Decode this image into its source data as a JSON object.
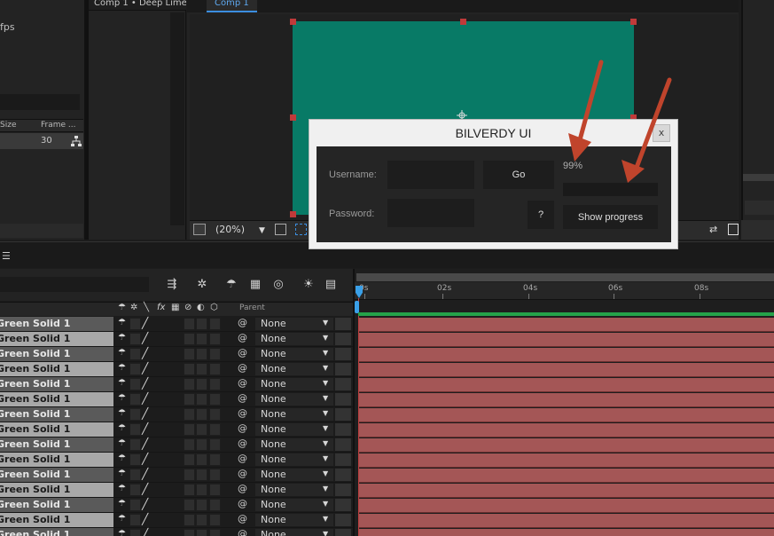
{
  "project_panel": {
    "fps_text": "fps",
    "columns": {
      "size": "Size",
      "frame": "Frame ..."
    },
    "row_frame_value": "30"
  },
  "flowchart_panel": {
    "tab_label": "Comp 1 • Deep Lime"
  },
  "composition_panel": {
    "tab_label": "Comp 1",
    "zoom_label": "(20%)",
    "solid_color": "#087a66"
  },
  "timeline": {
    "parent_column_label": "Parent",
    "ruler_labels": [
      "0s",
      "02s",
      "04s",
      "06s",
      "08s"
    ],
    "layers": [
      {
        "name": "Green Solid 1",
        "parent": "None"
      },
      {
        "name": "Green Solid 1",
        "parent": "None"
      },
      {
        "name": "Green Solid 1",
        "parent": "None"
      },
      {
        "name": "Green Solid 1",
        "parent": "None"
      },
      {
        "name": "Green Solid 1",
        "parent": "None"
      },
      {
        "name": "Green Solid 1",
        "parent": "None"
      },
      {
        "name": "Green Solid 1",
        "parent": "None"
      },
      {
        "name": "Green Solid 1",
        "parent": "None"
      },
      {
        "name": "Green Solid 1",
        "parent": "None"
      },
      {
        "name": "Green Solid 1",
        "parent": "None"
      },
      {
        "name": "Green Solid 1",
        "parent": "None"
      },
      {
        "name": "Green Solid 1",
        "parent": "None"
      },
      {
        "name": "Green Solid 1",
        "parent": "None"
      },
      {
        "name": "Green Solid 1",
        "parent": "None"
      },
      {
        "name": "Green Solid 1",
        "parent": "None"
      }
    ],
    "layer_bar_color": "#a45656"
  },
  "dialog": {
    "title": "BILVERDY UI",
    "close_label": "x",
    "username_label": "Username:",
    "password_label": "Password:",
    "username_value": "",
    "password_value": "",
    "go_label": "Go",
    "help_label": "?",
    "progress_text": "99%",
    "progress_value": 0.99,
    "show_progress_label": "Show progress"
  },
  "annotation": {
    "arrow_color": "#c0442c"
  }
}
